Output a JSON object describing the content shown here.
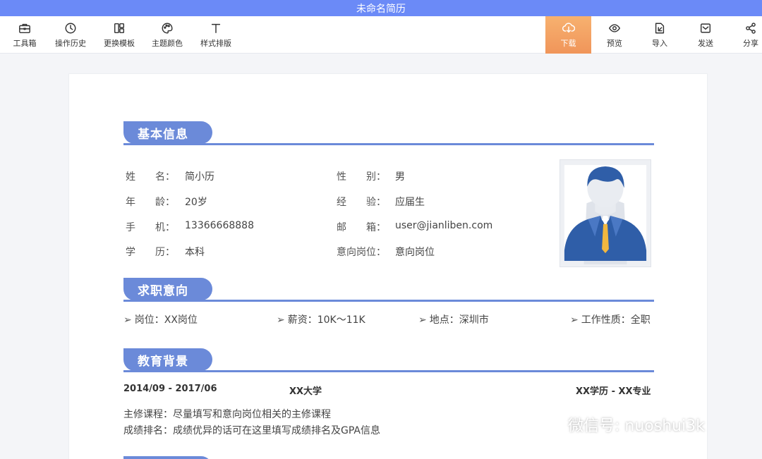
{
  "window": {
    "title": "未命名简历"
  },
  "toolbar": {
    "left": [
      {
        "label": "工具箱",
        "icon": "toolbox-icon"
      },
      {
        "label": "操作历史",
        "icon": "history-icon"
      },
      {
        "label": "更换模板",
        "icon": "template-icon"
      },
      {
        "label": "主题颜色",
        "icon": "palette-icon"
      },
      {
        "label": "样式排版",
        "icon": "text-icon"
      }
    ],
    "right": [
      {
        "label": "下载",
        "icon": "download-icon"
      },
      {
        "label": "预览",
        "icon": "eye-icon"
      },
      {
        "label": "导入",
        "icon": "import-icon"
      },
      {
        "label": "发送",
        "icon": "mail-icon"
      },
      {
        "label": "分享",
        "icon": "share-icon"
      }
    ]
  },
  "colors": {
    "accent": "#6b8ad9",
    "titlebar": "#6b8af7",
    "download": "#f0955a"
  },
  "sections": {
    "basic": {
      "title": "基本信息",
      "fields": [
        {
          "label": "姓　　名：",
          "value": "简小历"
        },
        {
          "label": "性　　别：",
          "value": "男"
        },
        {
          "label": "年　　龄：",
          "value": "20岁"
        },
        {
          "label": "经　　验：",
          "value": "应届生"
        },
        {
          "label": "手　　机：",
          "value": "13366668888"
        },
        {
          "label": "邮　　箱：",
          "value": "user@jianliben.com"
        },
        {
          "label": "学　　历：",
          "value": "本科"
        },
        {
          "label": "意向岗位：",
          "value": "意向岗位"
        }
      ]
    },
    "intent": {
      "title": "求职意向",
      "items": [
        "岗位：XX岗位",
        "薪资：10K～11K",
        "地点：深圳市",
        "工作性质：全职"
      ]
    },
    "education": {
      "title": "教育背景",
      "period": "2014/09 - 2017/06",
      "school": "XX大学",
      "degree": "XX学历 - XX专业",
      "courses": "主修课程：尽量填写和意向岗位相关的主修课程",
      "ranking": "成绩排名：成绩优异的话可在这里填写成绩排名及GPA信息"
    }
  },
  "watermark": {
    "text": "微信号: nuoshui3k"
  }
}
